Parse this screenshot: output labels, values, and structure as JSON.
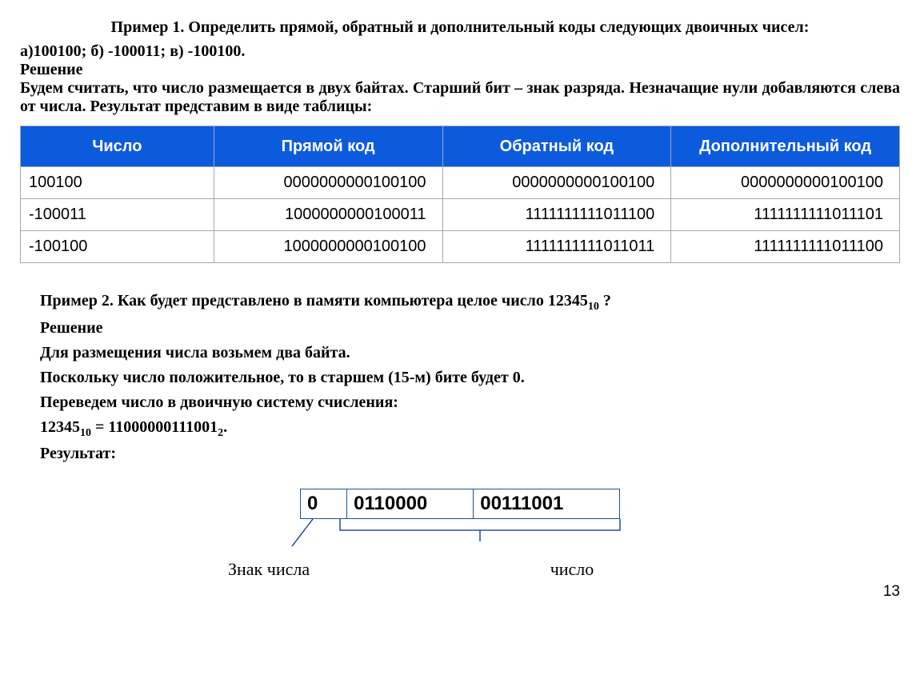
{
  "example1": {
    "title": "Пример 1. Определить прямой, обратный и дополнительный коды следующих двоичных чисел:",
    "items": "а)100100; б) -100011; в) -100100.",
    "solution_label": "Решение",
    "solution_text": "Будем считать, что число размещается в двух байтах. Старший бит – знак разряда. Незначащие нули добавляются слева от числа. Результат представим в виде таблицы:",
    "headers": {
      "number": "Число",
      "direct": "Прямой код",
      "inverse": "Обратный код",
      "complement": "Дополнительный код"
    },
    "rows": [
      {
        "number": "100100",
        "direct": "0000000000100100",
        "inverse": "0000000000100100",
        "complement": "0000000000100100"
      },
      {
        "number": "-100011",
        "direct": "1000000000100011",
        "inverse": "1111111111011100",
        "complement": "1111111111011101"
      },
      {
        "number": "-100100",
        "direct": "1000000000100100",
        "inverse": "1111111111011011",
        "complement": "1111111111011100"
      }
    ]
  },
  "example2": {
    "title_pre": "Пример 2. Как будет представлено в памяти компьютера целое число 12345",
    "title_sub": "10",
    "title_post": " ?",
    "solution_label": "Решение",
    "line1": "Для размещения числа возьмем два байта.",
    "line2": "Поскольку число положительное, то в старшем (15-м) бите будет 0.",
    "line3": "Переведем число в двоичную систему счисления:",
    "conv_pre": "12345",
    "conv_sub1": "10",
    "conv_mid": " = 11000000111001",
    "conv_sub2": "2",
    "conv_post": ".",
    "result_label": "Результат:",
    "mem": {
      "sign": "0",
      "high": "0110000",
      "low": "00111001"
    },
    "labels": {
      "sign": "Знак числа",
      "number": "число"
    }
  },
  "page_number": "13"
}
